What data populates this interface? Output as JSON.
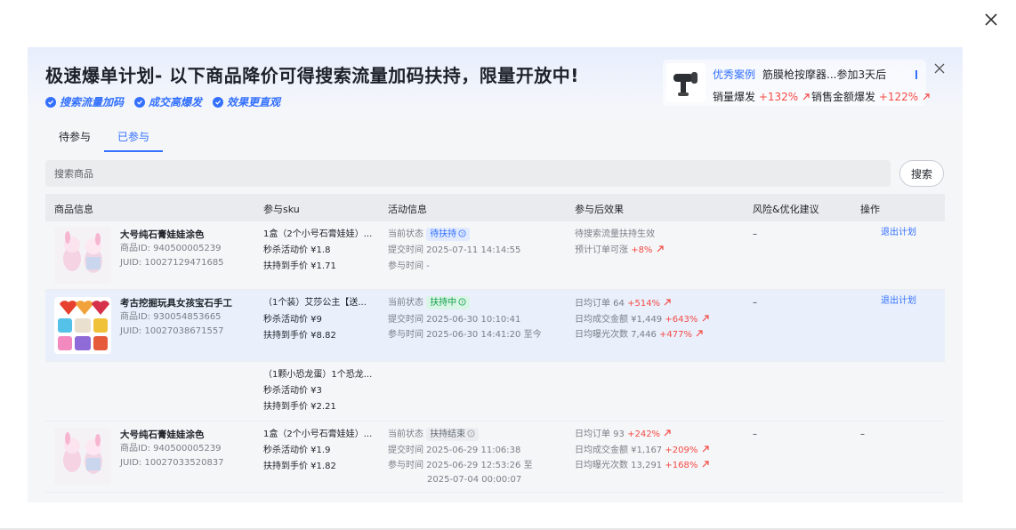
{
  "banner": {
    "title": "极速爆单计划- 以下商品降价可得搜索流量加码扶持，限量开放中!",
    "features": [
      "搜索流量加码",
      "成交高爆发",
      "效果更直观"
    ],
    "case": {
      "tag": "优秀案例",
      "name": "筋膜枪按摩器...参加3天后",
      "stat1_label": "销量爆发",
      "stat1_value": "+132%",
      "stat2_label": "销售金额爆发",
      "stat2_value": "+122%"
    }
  },
  "tabs": [
    "待参与",
    "已参与"
  ],
  "active_tab": "已参与",
  "search": {
    "placeholder": "搜索商品",
    "button": "搜索"
  },
  "table": {
    "headers": [
      "商品信息",
      "参与sku",
      "活动信息",
      "参与后效果",
      "风险&优化建议",
      "操作"
    ],
    "rows": [
      {
        "product": {
          "name": "大号纯石膏娃娃涂色",
          "id": "商品ID: 940500005239",
          "juid": "JUID: 10027129471685"
        },
        "sku": {
          "name": "1盒（2个小号石膏娃娃）...",
          "price1": "秒杀活动价  ¥1.8",
          "price2": "扶持到手价  ¥1.71"
        },
        "activity": {
          "status_label": "当前状态",
          "status": "待扶持",
          "submit": "提交时间  2025-07-11 14:14:55",
          "join": "参与时间  -",
          "join2": ""
        },
        "effect": {
          "l1": "待搜索流量扶持生效",
          "l2": "预计订单可涨",
          "l2v": "+8%",
          "l3": "",
          "l3v": "",
          "l1v": ""
        },
        "risk": "–",
        "action": "退出计划"
      },
      {
        "product": {
          "name": "考古挖掘玩具女孩宝石手工",
          "id": "商品ID: 930054853665",
          "juid": "JUID: 10027038671557"
        },
        "sku": {
          "name": "（1个装）艾莎公主【送...",
          "price1": "秒杀活动价  ¥9",
          "price2": "扶持到手价  ¥8.82"
        },
        "activity": {
          "status_label": "当前状态",
          "status": "扶持中",
          "submit": "提交时间  2025-06-30 10:10:41",
          "join": "参与时间  2025-06-30 14:41:20 至今",
          "join2": ""
        },
        "effect": {
          "l1": "日均订单  64",
          "l1v": "+514%",
          "l2": "日均成交金额  ¥1,449",
          "l2v": "+643%",
          "l3": "日均曝光次数  7,446",
          "l3v": "+477%"
        },
        "risk": "–",
        "action": "退出计划"
      },
      {
        "sku": {
          "name": "（1颗小恐龙蛋）1个恐龙...",
          "price1": "秒杀活动价  ¥3",
          "price2": "扶持到手价  ¥2.21"
        }
      },
      {
        "product": {
          "name": "大号纯石膏娃娃涂色",
          "id": "商品ID: 940500005239",
          "juid": "JUID: 10027033520837"
        },
        "sku": {
          "name": "1盒（2个小号石膏娃娃）...",
          "price1": "秒杀活动价  ¥1.9",
          "price2": "扶持到手价  ¥1.82"
        },
        "activity": {
          "status_label": "当前状态",
          "status": "扶持结束",
          "submit": "提交时间  2025-06-29 11:06:38",
          "join": "参与时间  2025-06-29 12:53:26 至",
          "join2": "2025-07-04 00:00:07"
        },
        "effect": {
          "l1": "日均订单  93",
          "l1v": "+242%",
          "l2": "日均成交金额  ¥1,167",
          "l2v": "+209%",
          "l3": "日均曝光次数  13,291",
          "l3v": "+168%"
        },
        "risk": "–",
        "action": "–"
      }
    ]
  },
  "colors": {
    "accent": "#3370ff",
    "positive": "#f54a45",
    "success": "#14a04e"
  }
}
